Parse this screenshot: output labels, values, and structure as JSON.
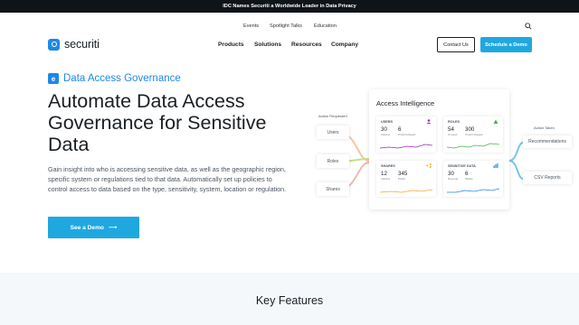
{
  "announcement": "IDC Names Securiti a Worldwide Leader in Data Privacy",
  "utility_nav": [
    "Events",
    "Spotlight Talks",
    "Education"
  ],
  "logo_text": "securiti",
  "main_nav": [
    "Products",
    "Solutions",
    "Resources",
    "Company"
  ],
  "contact_label": "Contact Us",
  "schedule_label": "Schedule a Demo",
  "eyebrow": "Data Access Governance",
  "hero_title": "Automate Data Access Governance for Sensitive Data",
  "hero_description": "Gain insight into who is accessing sensitive data, as well as the geographic region, specific system or regulations tied to that data. Automatically set up policies to control access to data based on the type, sensitivity, system, location or regulation.",
  "cta_label": "See a Demo",
  "cta_arrow": "⟶",
  "illustration": {
    "card_title": "Access Intelligence",
    "left_label": "Action Requested",
    "right_label": "Action Taken",
    "left_pills": [
      "Users",
      "Roles",
      "Shares"
    ],
    "right_pills": [
      "Recommendations",
      "CSV Reports"
    ],
    "tiles": [
      {
        "label": "USERS",
        "v1": "30",
        "s1": "Inactive",
        "v2": "6",
        "s2": "Overprivileged",
        "icon": "user-icon",
        "color": "#9c27b0"
      },
      {
        "label": "ROLES",
        "v1": "54",
        "s1": "Unused",
        "v2": "300",
        "s2": "Overprivileged",
        "icon": "role-icon",
        "color": "#4caf50"
      },
      {
        "label": "SHARES",
        "v1": "12",
        "s1": "Inactive",
        "v2": "345",
        "s2": "Public",
        "icon": "share-icon",
        "color": "#f9a825"
      },
      {
        "label": "SENSITIVE DATA",
        "v1": "30",
        "s1": "Records",
        "v2": "6",
        "s2": "Tables",
        "icon": "data-icon",
        "color": "#1e88e5"
      }
    ]
  },
  "features_title": "Key Features",
  "colors": {
    "accent": "#1fa8e0",
    "brand": "#1e88e5",
    "dark": "#0f1419"
  }
}
